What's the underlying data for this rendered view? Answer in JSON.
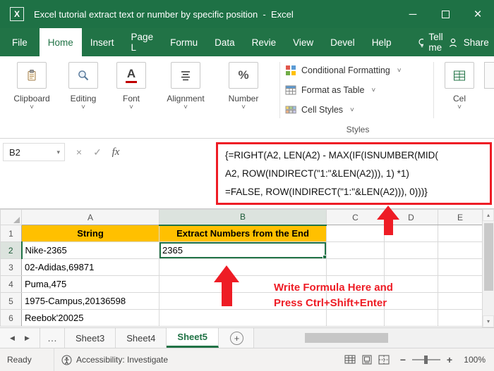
{
  "colors": {
    "excel_green": "#217346",
    "titlebar_green": "#1E7145",
    "header_gold": "#FFC000",
    "annotation_red": "#EE1C25"
  },
  "icons": {
    "excel_x": "X",
    "minimize": "─",
    "close": "×",
    "cancel": "×",
    "check": "✓",
    "chevron_down": "˅",
    "caret_down": "▾",
    "caret_up": "▴",
    "scroll_left": "◀",
    "scroll_right": "▶",
    "plus": "+",
    "minus": "−",
    "percent": "%",
    "font_a": "A"
  },
  "titlebar": {
    "title": "Excel tutorial extract text or number by specific position  -  Excel"
  },
  "ribbon": {
    "tabs": [
      {
        "label": "File"
      },
      {
        "label": "Home"
      },
      {
        "label": "Insert"
      },
      {
        "label": "Page L"
      },
      {
        "label": "Formu"
      },
      {
        "label": "Data"
      },
      {
        "label": "Revie"
      },
      {
        "label": "View"
      },
      {
        "label": "Devel"
      },
      {
        "label": "Help"
      }
    ],
    "tell_me": "Tell me",
    "share": "Share",
    "groups": [
      {
        "label": "Clipboard"
      },
      {
        "label": "Editing"
      },
      {
        "label": "Font"
      },
      {
        "label": "Alignment"
      },
      {
        "label": "Number"
      }
    ],
    "styles": {
      "items": [
        {
          "label": "Conditional Formatting"
        },
        {
          "label": "Format as Table"
        },
        {
          "label": "Cell Styles"
        }
      ],
      "caption": "Styles"
    },
    "cells_partial": "Cel"
  },
  "formula_bar": {
    "name_box": "B2",
    "fx": "fx",
    "lines": [
      "{=RIGHT(A2, LEN(A2) - MAX(IF(ISNUMBER(MID(",
      "A2, ROW(INDIRECT(\"1:\"&LEN(A2))), 1) *1)",
      "=FALSE, ROW(INDIRECT(\"1:\"&LEN(A2))), 0)))}"
    ]
  },
  "grid": {
    "columns": [
      "A",
      "B",
      "C",
      "D",
      "E"
    ],
    "rows": [
      {
        "num": "1",
        "A": "String",
        "B": "Extract Numbers from the End"
      },
      {
        "num": "2",
        "A": "Nike-2365",
        "B": "2365"
      },
      {
        "num": "3",
        "A": "02-Adidas,69871",
        "B": ""
      },
      {
        "num": "4",
        "A": "Puma,475",
        "B": ""
      },
      {
        "num": "5",
        "A": "1975-Campus,20136598",
        "B": ""
      },
      {
        "num": "6",
        "A": "Reebok'20025",
        "B": ""
      }
    ],
    "selected_cell": "B2"
  },
  "annotation": {
    "line1": "Write Formula Here and",
    "line2": "Press Ctrl+Shift+Enter"
  },
  "sheet_bar": {
    "ellipsis": "…",
    "tabs": [
      {
        "label": "Sheet3"
      },
      {
        "label": "Sheet4"
      },
      {
        "label": "Sheet5"
      }
    ],
    "active_tab": "Sheet5"
  },
  "status_bar": {
    "mode": "Ready",
    "accessibility": "Accessibility: Investigate",
    "zoom_level": "100%"
  }
}
